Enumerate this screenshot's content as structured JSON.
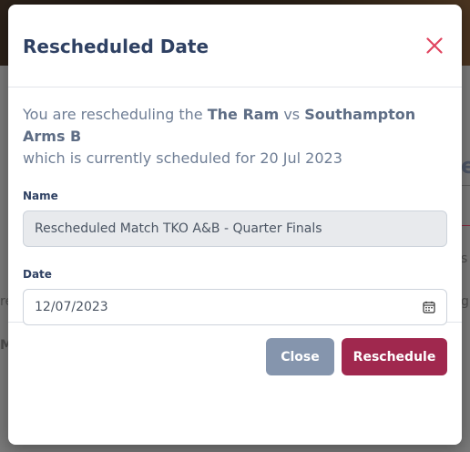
{
  "modal": {
    "title": "Rescheduled Date",
    "intro": {
      "prefix": "You are rescheduling the ",
      "home_team": "The Ram",
      "versus": " vs ",
      "away_team": "Southampton Arms B",
      "suffix": "which is currently scheduled for 20 Jul 2023"
    },
    "name_field": {
      "label": "Name",
      "value": "Rescheduled Match TKO A&B - Quarter Finals"
    },
    "date_field": {
      "label": "Date",
      "value": "12/07/2023",
      "icon": "calendar-icon"
    },
    "buttons": {
      "close": "Close",
      "reschedule": "Reschedule"
    }
  },
  "background": {
    "heading_fragment": "e",
    "frag_1": "s",
    "frag_2": "g",
    "frag_3": "re",
    "frag_4": "M"
  },
  "colors": {
    "title": "#2f4163",
    "close_x": "#e0445f",
    "close_button": "#8595ad",
    "reschedule_button": "#a0284e"
  }
}
